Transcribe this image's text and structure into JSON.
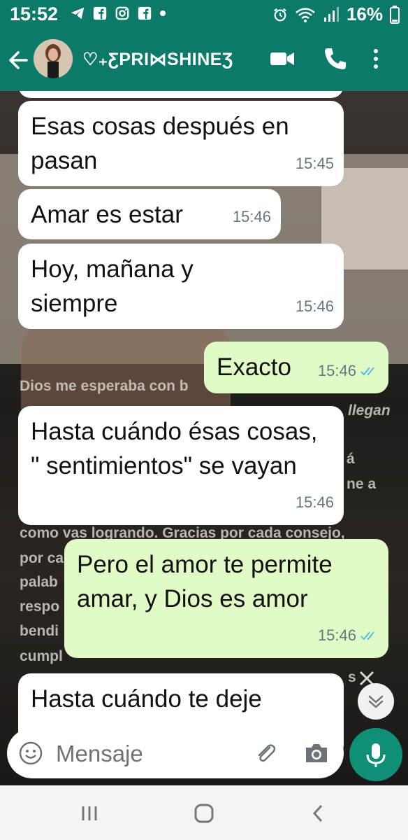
{
  "status_bar": {
    "time": "15:52",
    "battery": "16%",
    "left_icons": [
      "telegram-icon",
      "facebook-icon",
      "instagram-icon",
      "facebook-icon",
      "dot-icon"
    ],
    "right_icons": [
      "alarm-icon",
      "wifi-icon",
      "signal-icon"
    ]
  },
  "header": {
    "contact_name": "♡₊ƸPRI⋈SHINEƷ",
    "actions": [
      "video-call-icon",
      "phone-call-icon",
      "more-options-icon"
    ],
    "colors": {
      "bar": "#0b7a68"
    }
  },
  "background_text": [
    "Dios me esperaba con b",
    "llegan",
    "á",
    "ne a",
    "como vas logrando. Gracias por cada consejo,",
    "por ca",
    "palab",
    "respo",
    "bendi",
    "cumpl",
    "s"
  ],
  "messages": [
    {
      "direction": "incoming",
      "text": "Esas cosas después en pasan",
      "time": "15:45"
    },
    {
      "direction": "incoming",
      "text": "Amar es estar",
      "time": "15:46"
    },
    {
      "direction": "incoming",
      "text": "Hoy, mañana y siempre",
      "time": "15:46"
    },
    {
      "direction": "outgoing",
      "text": "Exacto",
      "time": "15:46",
      "status": "read"
    },
    {
      "direction": "incoming",
      "text": "Hasta cuándo ésas cosas, \" sentimientos\" se vayan",
      "time": "15:46"
    },
    {
      "direction": "outgoing",
      "text": "Pero el amor te permite amar, y Dios es amor",
      "time": "15:46",
      "status": "read"
    },
    {
      "direction": "incoming",
      "text": "Hasta cuándo te deje",
      "time": ""
    }
  ],
  "composer": {
    "placeholder": "Mensaje",
    "icons": [
      "emoji-icon",
      "attach-icon",
      "camera-icon",
      "mic-icon"
    ]
  },
  "nav_bar": {
    "icons": [
      "recent-apps-icon",
      "home-icon",
      "back-icon"
    ]
  },
  "colors": {
    "incoming_bubble": "#ffffff",
    "outgoing_bubble": "#e1fbc6",
    "read_ticks": "#53bdeb",
    "mic_button": "#0e8f76"
  }
}
